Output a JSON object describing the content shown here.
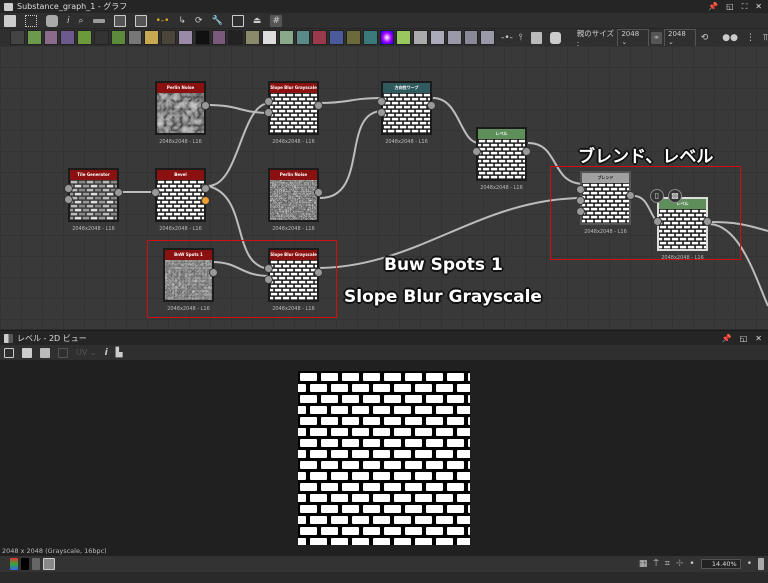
{
  "graph_window": {
    "title": "Substance_graph_1 - グラフ",
    "parent_size_label": "親のサイズ :",
    "width_value": "2048",
    "height_value": "2048"
  },
  "nodes": [
    {
      "id": "perlin1",
      "title": "Perlin Noise",
      "footer": "2048x2048 - L16",
      "header_color": "#8b1010",
      "thumb": "noise-coarse"
    },
    {
      "id": "slope1",
      "title": "Slope Blur Grayscale",
      "footer": "2048x2048 - L16",
      "header_color": "#8b1010",
      "thumb": "bricks"
    },
    {
      "id": "dirwarp",
      "title": "方向性ワープ",
      "footer": "2048x2048 - L16",
      "header_color": "#2f5b5e",
      "thumb": "bricks"
    },
    {
      "id": "level1",
      "title": "レベル",
      "footer": "2048x2048 - L16",
      "header_color": "#5e8e5a",
      "thumb": "bricks"
    },
    {
      "id": "tile",
      "title": "Tile Generator",
      "footer": "2048x2048 - L16",
      "header_color": "#8b1010",
      "thumb": "bricks-gray"
    },
    {
      "id": "bevel",
      "title": "Bevel",
      "footer": "2048x2048 - L16",
      "header_color": "#8b1010",
      "thumb": "bricks"
    },
    {
      "id": "perlin2",
      "title": "Perlin Noise",
      "footer": "2048x2048 - L16",
      "header_color": "#8b1010",
      "thumb": "noise-fine"
    },
    {
      "id": "bnw",
      "title": "BnW Spots 1",
      "footer": "2048x2048 - L16",
      "header_color": "#8b1010",
      "thumb": "noise-dark"
    },
    {
      "id": "slope2",
      "title": "Slope Blur Grayscale",
      "footer": "2048x2048 - L16",
      "header_color": "#8b1010",
      "thumb": "bricks"
    },
    {
      "id": "blend",
      "title": "ブレンド",
      "footer": "2048x2048 - L16",
      "header_color": "#a0a0a0",
      "thumb": "bricks"
    },
    {
      "id": "level2",
      "title": "レベル",
      "footer": "2048x2048 - L16",
      "header_color": "#5e8e5a",
      "thumb": "bricks"
    }
  ],
  "annotations": {
    "blend_level": "ブレンド、レベル",
    "bnw_spots": "Buw Spots 1",
    "slope_blur": "Slope Blur Grayscale"
  },
  "view2d": {
    "title": "レベル - 2D ビュー",
    "uv_label": "UV",
    "status": "2048 x 2048 (Grayscale, 16bpc)",
    "zoom": "14.40%"
  },
  "colors": {
    "accent_red": "#d01010",
    "selected_pin": "#f0a030"
  }
}
